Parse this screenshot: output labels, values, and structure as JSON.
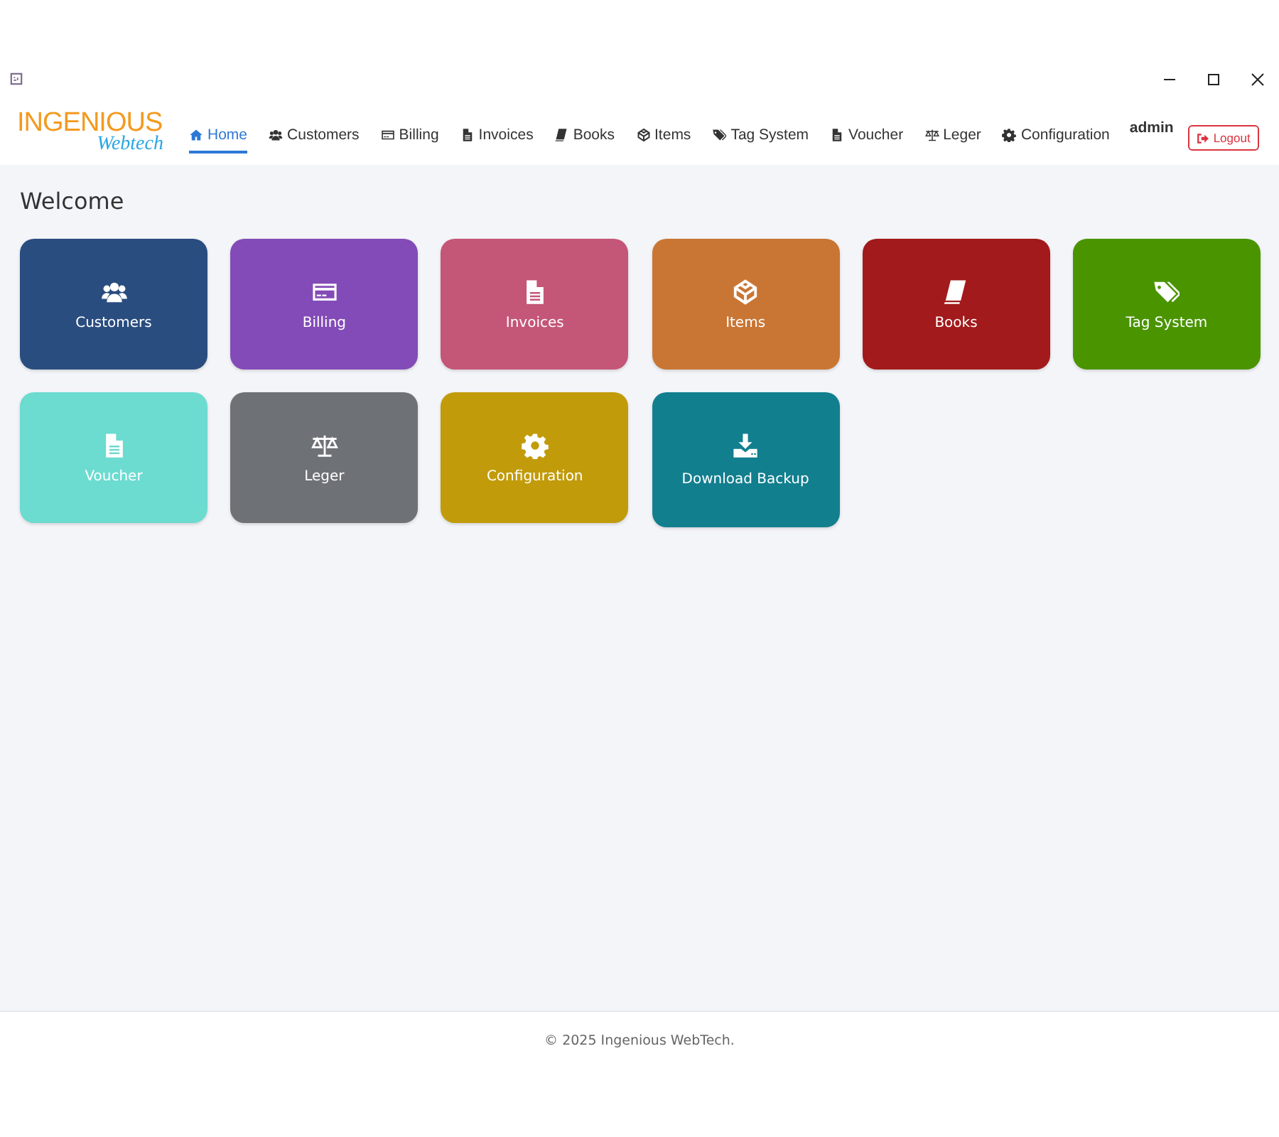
{
  "logo": {
    "title": "INGENIOUS",
    "subtitle": "Webtech"
  },
  "nav": [
    {
      "label": "Home",
      "kind": "home",
      "selected": true
    },
    {
      "label": "Customers",
      "kind": "users",
      "selected": false
    },
    {
      "label": "Billing",
      "kind": "card",
      "selected": false
    },
    {
      "label": "Invoices",
      "kind": "file",
      "selected": false
    },
    {
      "label": "Books",
      "kind": "book",
      "selected": false
    },
    {
      "label": "Items",
      "kind": "cube",
      "selected": false
    },
    {
      "label": "Tag System",
      "kind": "tags",
      "selected": false
    },
    {
      "label": "Voucher",
      "kind": "file",
      "selected": false
    },
    {
      "label": "Leger",
      "kind": "scale",
      "selected": false
    },
    {
      "label": "Configuration",
      "kind": "gear",
      "selected": false
    }
  ],
  "user": "admin",
  "logout": "Logout",
  "heading": "Welcome",
  "tiles": [
    {
      "label": "Customers",
      "kind": "users",
      "color": "#2a4d80"
    },
    {
      "label": "Billing",
      "kind": "card",
      "color": "#834bb7"
    },
    {
      "label": "Invoices",
      "kind": "file",
      "color": "#c45678"
    },
    {
      "label": "Items",
      "kind": "cube",
      "color": "#c97634"
    },
    {
      "label": "Books",
      "kind": "book",
      "color": "#a21a1b"
    },
    {
      "label": "Tag System",
      "kind": "tags",
      "color": "#4a9400"
    },
    {
      "label": "Voucher",
      "kind": "file",
      "color": "#6cdbd0"
    },
    {
      "label": "Leger",
      "kind": "scale",
      "color": "#6e7175"
    },
    {
      "label": "Configuration",
      "kind": "gear",
      "color": "#c19b0a"
    },
    {
      "label": "Download Backup",
      "kind": "download",
      "color": "#127f8f"
    }
  ],
  "footer": "© 2025 Ingenious WebTech."
}
